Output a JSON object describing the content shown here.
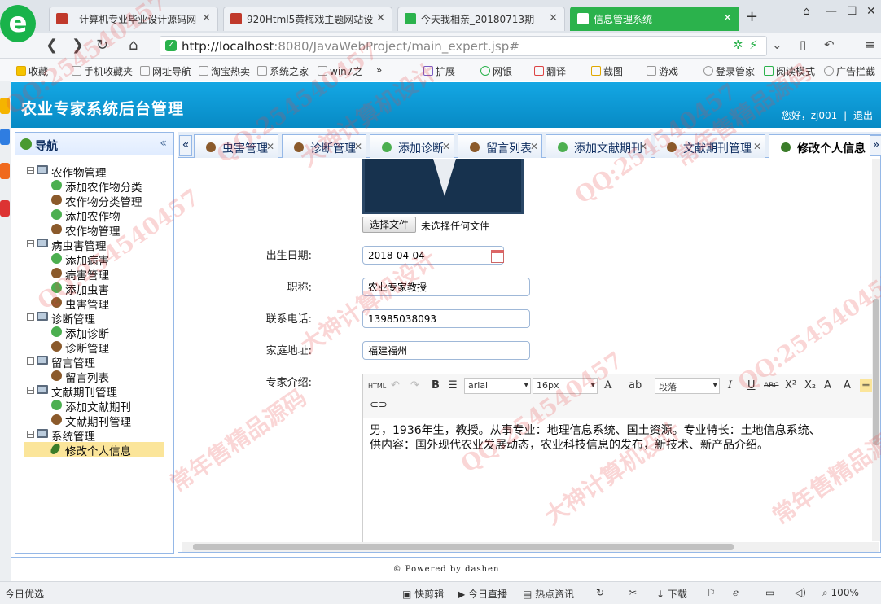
{
  "browser": {
    "tabs": [
      {
        "title": "- 计算机专业毕业设计源码网",
        "active": false
      },
      {
        "title": "920Html5黄梅戏主题网站设",
        "active": false
      },
      {
        "title": "今天我相亲_20180713期-",
        "active": false
      },
      {
        "title": "信息管理系统",
        "active": true
      }
    ],
    "url_host": "http://localhost",
    "url_path": ":8080/JavaWebProject/main_expert.jsp#",
    "favorites": [
      "收藏",
      "手机收藏夹",
      "网址导航",
      "淘宝热卖",
      "系统之家",
      "win7之",
      "»",
      "扩展",
      "网银",
      "翻译",
      "截图",
      "游戏",
      "登录管家",
      "阅读模式",
      "广告拦截"
    ]
  },
  "header": {
    "title": "农业专家系统后台管理",
    "greeting": "您好，zj001",
    "separator": "|",
    "logout": "退出"
  },
  "nav": {
    "title": "导航",
    "collapse_icon": "«",
    "groups": [
      {
        "label": "农作物管理",
        "items": [
          {
            "label": "添加农作物分类",
            "icon": "add"
          },
          {
            "label": "农作物分类管理",
            "icon": "mgr"
          },
          {
            "label": "添加农作物",
            "icon": "add"
          },
          {
            "label": "农作物管理",
            "icon": "mgr"
          }
        ]
      },
      {
        "label": "病虫害管理",
        "items": [
          {
            "label": "添加病害",
            "icon": "add"
          },
          {
            "label": "病害管理",
            "icon": "mgr"
          },
          {
            "label": "添加虫害",
            "icon": "add"
          },
          {
            "label": "虫害管理",
            "icon": "mgr"
          }
        ]
      },
      {
        "label": "诊断管理",
        "items": [
          {
            "label": "添加诊断",
            "icon": "add"
          },
          {
            "label": "诊断管理",
            "icon": "mgr"
          }
        ]
      },
      {
        "label": "留言管理",
        "items": [
          {
            "label": "留言列表",
            "icon": "mgr"
          }
        ]
      },
      {
        "label": "文献期刊管理",
        "items": [
          {
            "label": "添加文献期刊",
            "icon": "add"
          },
          {
            "label": "文献期刊管理",
            "icon": "mgr"
          }
        ]
      },
      {
        "label": "系统管理",
        "items": [
          {
            "label": "修改个人信息",
            "icon": "pen",
            "selected": true
          }
        ]
      }
    ]
  },
  "tabs": [
    {
      "label": "虫害管理",
      "icon": "mgr"
    },
    {
      "label": "诊断管理",
      "icon": "mgr"
    },
    {
      "label": "添加诊断",
      "icon": "add"
    },
    {
      "label": "留言列表",
      "icon": "mgr"
    },
    {
      "label": "添加文献期刊",
      "icon": "add"
    },
    {
      "label": "文献期刊管理",
      "icon": "mgr"
    },
    {
      "label": "修改个人信息",
      "icon": "pen",
      "active": true
    }
  ],
  "form": {
    "file_button": "选择文件",
    "file_status": "未选择任何文件",
    "birth_label": "出生日期:",
    "birth_value": "2018-04-04",
    "title_label": "职称:",
    "title_value": "农业专家教授",
    "phone_label": "联系电话:",
    "phone_value": "13985038093",
    "address_label": "家庭地址:",
    "address_value": "福建福州",
    "intro_label": "专家介绍:",
    "intro_text": "男，1936年生，教授。从事专业：地理信息系统、国土资源。专业特长：土地信息系统、\n供内容：国外现代农业发展动态，农业科技信息的发布，新技术、新产品介绍。"
  },
  "editor": {
    "html_btn": "HTML",
    "bold": "B",
    "font_family": "arial",
    "font_size": "16px",
    "font_color": "A",
    "paragraph": "段落",
    "italic": "I",
    "underline": "U",
    "strike": "ABC",
    "superscript": "X²",
    "subscript": "X₂"
  },
  "footer": {
    "text": "© Powered by dashen"
  },
  "status": {
    "left": "今日优选",
    "items": [
      "快剪辑",
      "今日直播",
      "热点资讯",
      "下载",
      "100%"
    ]
  },
  "watermarks": [
    "QQ:254540457",
    "大神计算机设计",
    "常年售精品源码"
  ]
}
